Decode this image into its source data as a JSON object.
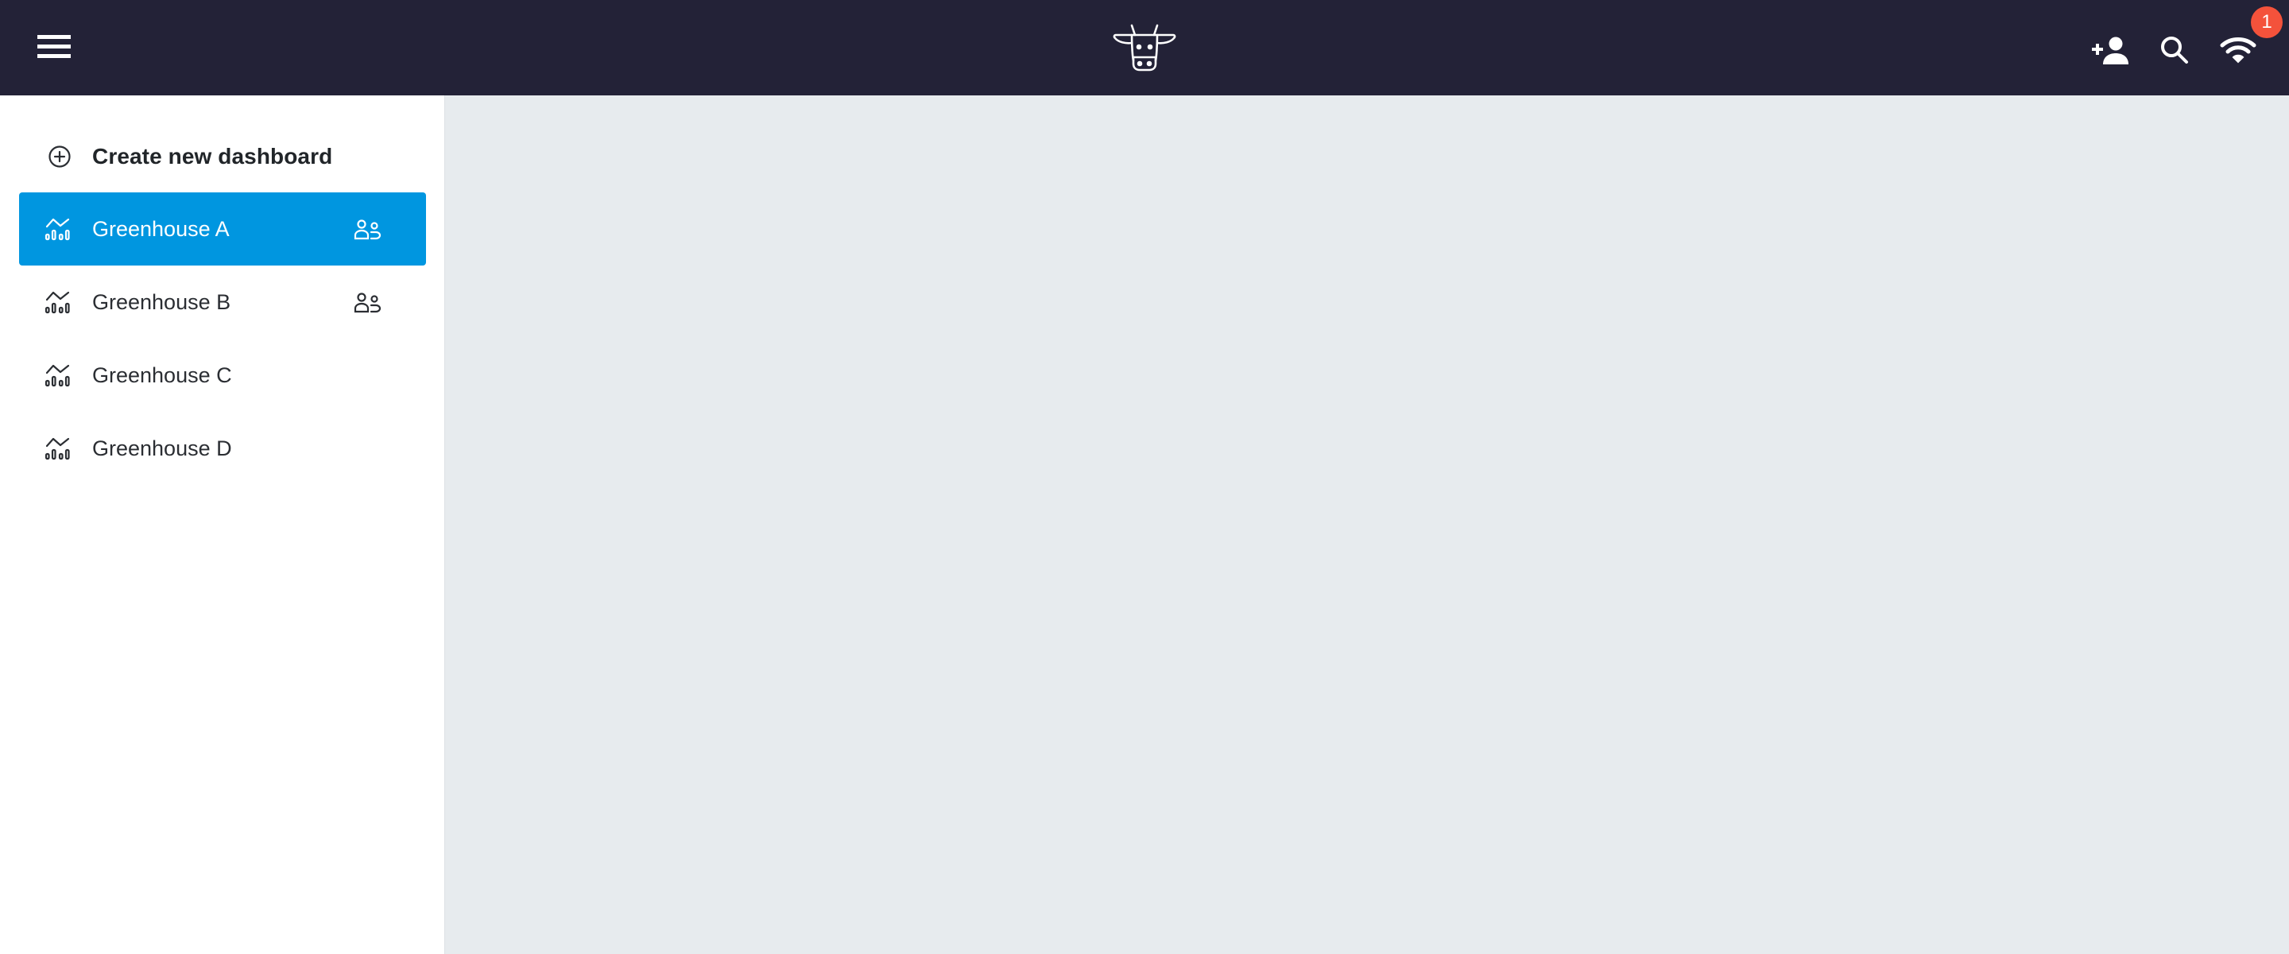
{
  "header": {
    "menu_icon": "hamburger-menu-icon",
    "logo": "cow-logo",
    "actions": [
      {
        "name": "add-user",
        "icon": "person-add-icon"
      },
      {
        "name": "search",
        "icon": "search-icon"
      },
      {
        "name": "connection-status",
        "icon": "wifi-icon"
      }
    ],
    "notification_count": "1",
    "colors": {
      "background": "#232237",
      "badge": "#f4523b"
    }
  },
  "sidebar": {
    "create_label": "Create new dashboard",
    "create_icon": "add-circle-icon",
    "active_color": "#0096e0",
    "items": [
      {
        "label": "Greenhouse A",
        "icon": "analytics-chart-icon",
        "shared": true,
        "active": true
      },
      {
        "label": "Greenhouse B",
        "icon": "analytics-chart-icon",
        "shared": true,
        "active": false
      },
      {
        "label": "Greenhouse C",
        "icon": "analytics-chart-icon",
        "shared": false,
        "active": false
      },
      {
        "label": "Greenhouse D",
        "icon": "analytics-chart-icon",
        "shared": false,
        "active": false
      }
    ]
  },
  "main": {
    "background": "#e7ebee"
  }
}
